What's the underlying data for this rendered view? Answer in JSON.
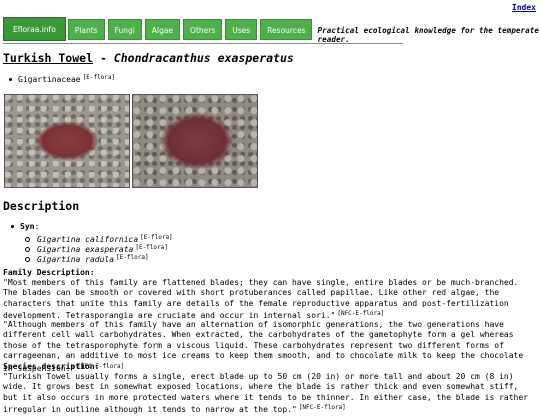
{
  "header": {
    "index_label": "Index",
    "nav": [
      {
        "label": "Efloraa.info"
      },
      {
        "label": "Plants"
      },
      {
        "label": "Fungi"
      },
      {
        "label": "Algae"
      },
      {
        "label": "Others"
      },
      {
        "label": "Uses"
      },
      {
        "label": "Resources"
      }
    ],
    "tagline": "Practical ecological knowledge for the temperate reader."
  },
  "page": {
    "common_name": "Turkish Towel",
    "separator": " - ",
    "scientific_name": "Chondracanthus exasperatus",
    "family": "Gigartinaceae",
    "family_ref": "[E-flora]"
  },
  "description": {
    "heading": "Description",
    "syn_label": "Syn",
    "syn_colon": ":",
    "synonyms": [
      {
        "name": "Gigartina californica",
        "ref": "[E-flora]"
      },
      {
        "name": "Gigartina exasperata",
        "ref": "[E-flora]"
      },
      {
        "name": "Gigartina radula",
        "ref": "[E-flora]"
      }
    ],
    "family_desc_label": "Family Description:",
    "family_desc_p1": "\"Most members of this family are flattened blades; they can have single, entire blades or be much-branched. The blades can be smooth or covered with short protuberances called papillae. Like other red algae, the characters that unite this family are details of the female reproductive apparatus and post-fertilization development. Tetrasporangia are cruciate and occur in internal sori.\"",
    "family_desc_p1_ref": "[NFC-E-flora]",
    "family_desc_p2": "\"Although members of this family have an alternation of isomorphic generations, the two generations have different cell wall carbohydrates. When extracted, the carbohydrates of the gametophyte form a gel whereas those of the tetrasporophyte form a viscous liquid. These carbohydrates represent two different forms of carrageenan, an additive to most ice creams to keep them smooth, and to chocolate milk to keep the chocolate in suspension.\"",
    "family_desc_p2_ref": "[NFC-E-flora]",
    "species_desc_label": "Species description:",
    "species_desc": "\"Turkish Towel usually forms a single, erect blade up to 50 cm (20 in) or more tall and about 20 cm (8 in) wide. It grows best in somewhat exposed locations, where the blade is rather thick and even somewhat stiff, but it also occurs in more protected waters where it tends to be thinner. In either case, the blade is rather irregular in outline although it tends to narrow at the top.\"",
    "species_desc_ref": "[NFC-E-flora]"
  }
}
